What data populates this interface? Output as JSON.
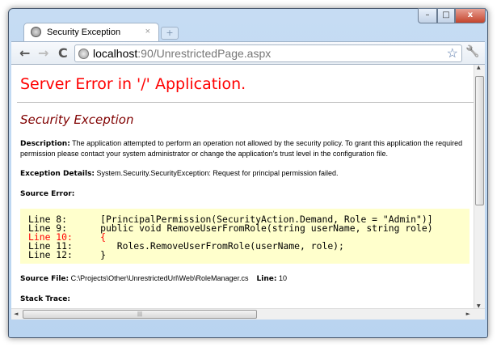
{
  "browser": {
    "tab_title": "Security Exception",
    "new_tab": "+",
    "minimize": "–",
    "maximize": "□",
    "close": "x",
    "back": "←",
    "forward": "→",
    "reload": "C",
    "url_host": "localhost",
    "url_rest": ":90/UnrestrictedPage.aspx",
    "star": "☆",
    "wrench": "🔧"
  },
  "page": {
    "title": "Server Error in '/' Application.",
    "subtitle": "Security Exception",
    "description_label": "Description:",
    "description": " The application attempted to perform an operation not allowed by the security policy.  To grant this application the required permission please contact your system administrator or change the application's trust level in the configuration file.",
    "details_label": "Exception Details:",
    "details": " System.Security.SecurityException: Request for principal permission failed.",
    "source_error_label": "Source Error:",
    "code": [
      {
        "text": "Line 8:      [PrincipalPermission(SecurityAction.Demand, Role = \"Admin\")]",
        "error": false
      },
      {
        "text": "Line 9:      public void RemoveUserFromRole(string userName, string role)",
        "error": false
      },
      {
        "text": "Line 10:     {",
        "error": true
      },
      {
        "text": "Line 11:        Roles.RemoveUserFromRole(userName, role);",
        "error": false
      },
      {
        "text": "Line 12:     }",
        "error": false
      }
    ],
    "source_file_label": "Source File:",
    "source_file": " C:\\Projects\\Other\\UnrestrictedUrl\\Web\\RoleManager.cs",
    "line_label": "Line:",
    "line": " 10",
    "stack_trace_label": "Stack Trace:"
  },
  "scroll": {
    "up": "▲",
    "down": "▼",
    "left": "◄",
    "right": "►",
    "grip": "|||"
  }
}
